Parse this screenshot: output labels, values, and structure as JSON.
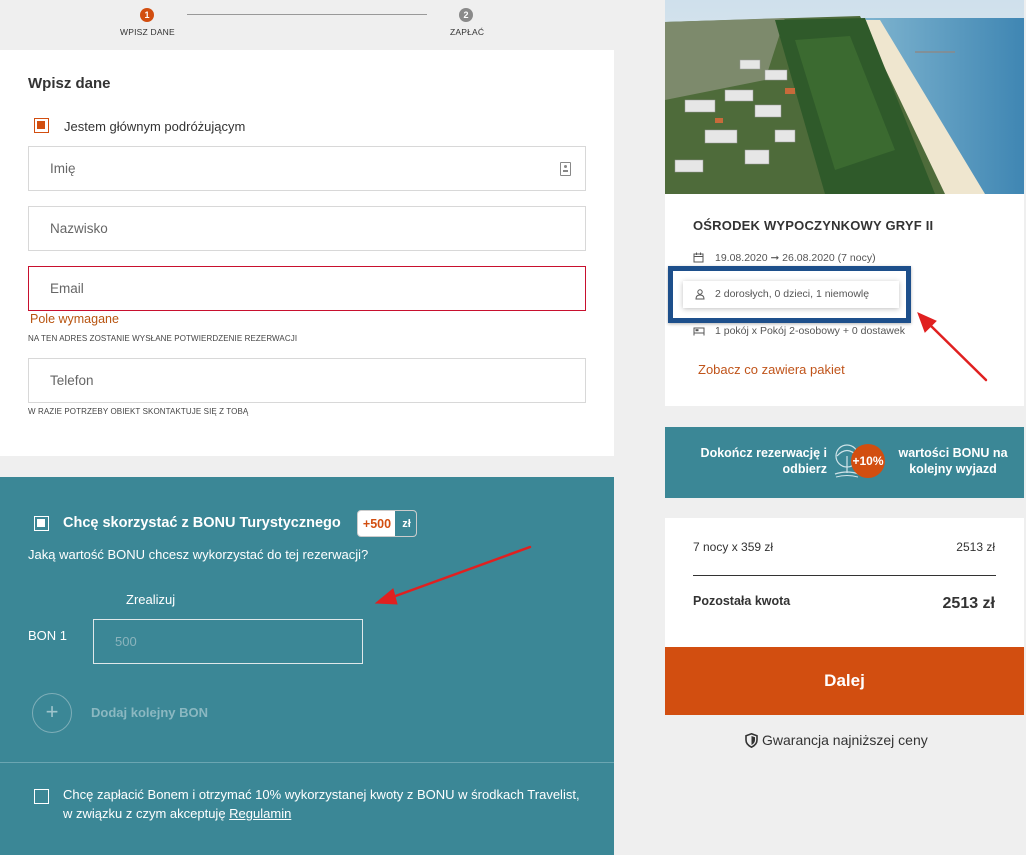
{
  "steps": [
    {
      "number": "1",
      "label": "WPISZ DANE",
      "color": "#d24e10"
    },
    {
      "number": "2",
      "label": "ZAPŁAĆ",
      "color": "#8a8a8a"
    }
  ],
  "form": {
    "title": "Wpisz dane",
    "main_traveler_label": "Jestem głównym podróżującym",
    "first_name_placeholder": "Imię",
    "last_name_placeholder": "Nazwisko",
    "email_placeholder": "Email",
    "email_error": "Pole wymagane",
    "email_hint": "NA TEN ADRES ZOSTANIE WYSŁANE POTWIERDZENIE REZERWACJI",
    "phone_placeholder": "Telefon",
    "phone_hint": "W RAZIE POTRZEBY OBIEKT SKONTAKTUJE SIĘ Z TOBĄ"
  },
  "bon": {
    "checkbox_label": "Chcę skorzystać z BONU Turystycznego",
    "badge_amount": "+500",
    "badge_currency": "zł",
    "question": "Jaką wartość BONU chcesz wykorzystać do tej rezerwacji?",
    "realize_label": "Zrealizuj",
    "bon1_label": "BON 1",
    "bon1_placeholder": "500",
    "add_icon": "+",
    "add_label": "Dodaj kolejny BON",
    "accept_text": "Chcę zapłacić Bonem i otrzymać 10% wykorzystanej kwoty z BONU w środkach Travelist, w związku z czym akceptuję ",
    "accept_link": "Regulamin"
  },
  "hotel": {
    "name": "OŚRODEK WYPOCZYNKOWY GRYF II",
    "dates": "19.08.2020 ➞ 26.08.2020 (7 nocy)",
    "guests": "2 dorosłych, 0 dzieci, 1 niemowlę",
    "rooms": "1 pokój x Pokój 2-osobowy + 0 dostawek",
    "package_link": "Zobacz co zawiera pakiet"
  },
  "promo": {
    "left_text": "Dokończ rezerwację i odbierz",
    "badge": "+10%",
    "right_text": "wartości BONU na kolejny wyjazd"
  },
  "price": {
    "row_label": "7 nocy x 359 zł",
    "row_value": "2513 zł",
    "remaining_label": "Pozostała kwota",
    "remaining_value": "2513 zł"
  },
  "actions": {
    "next_label": "Dalej",
    "guarantee": "Gwarancja najniższej ceny"
  },
  "colors": {
    "accent": "#d24e10",
    "teal": "#3b8796",
    "highlight": "#1d4f8b",
    "annotation_arrow": "#e02020"
  }
}
